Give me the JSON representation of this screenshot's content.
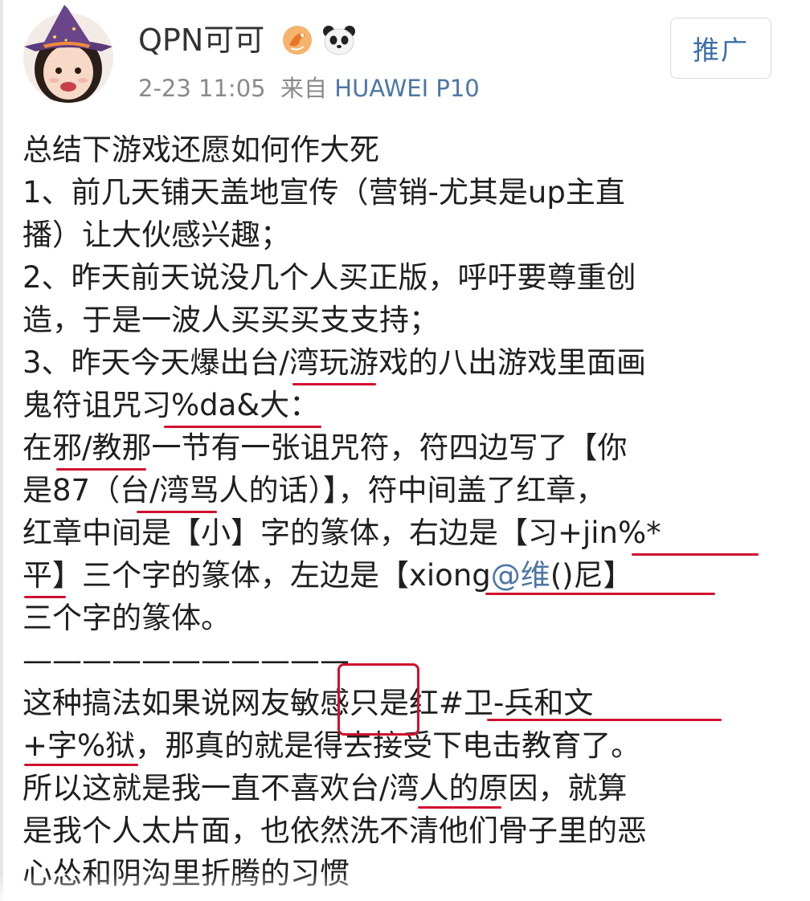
{
  "post": {
    "username": "QPN可可",
    "time": "2-23 11:05",
    "from_label": "来自",
    "device": "HUAWEI P10",
    "promote_label": "推广",
    "lines": [
      "总结下游戏还愿如何作大死",
      "1、前几天铺天盖地宣传（营销-尤其是up主直",
      "播）让大伙感兴趣；",
      "2、昨天前天说没几个人买正版，呼吁要尊重创",
      "造，于是一波人买买买支支持；",
      "3、昨天今天爆出台/湾玩游戏的八出游戏里面画",
      "鬼符诅咒习%da&大：",
      "在邪/教那一节有一张诅咒符，符四边写了【你",
      "是87（台/湾骂人的话）】，符中间盖了红章，",
      "红章中间是【小】字的篆体，右边是【习+jin%*",
      "平】三个字的篆体，左边是【xiong",
      "三个字的篆体。",
      "———————————",
      "这种搞法如果说网友敏感只是红#卫-兵和文",
      "+字%狱，那真的就是得去接受下电击教育了。",
      "所以这就是我一直不喜欢台/湾人的原因，就算",
      "是我个人太片面，也依然洗不清他们骨子里的恶",
      "心怂和阴沟里折腾的习惯"
    ],
    "mention": "@维",
    "line10_tail": "()尼】"
  },
  "icons": {
    "avatar": "child-witch-hat-avatar",
    "badge1": "fox-badge-icon",
    "badge2": "panda-badge-icon"
  },
  "colors": {
    "link": "#4d76a5",
    "annotation": "#d0102f",
    "meta": "#8a8a8a"
  }
}
